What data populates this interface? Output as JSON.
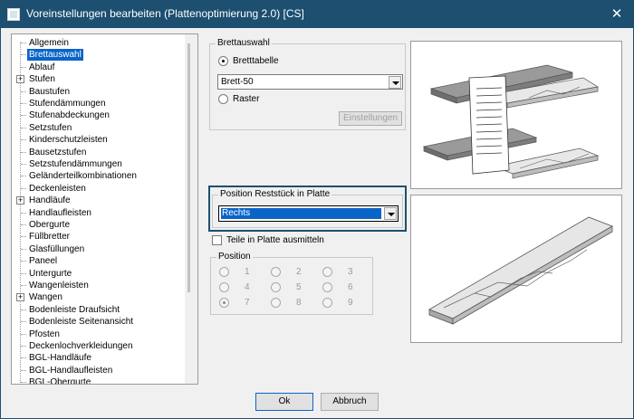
{
  "window": {
    "title": "Voreinstellungen bearbeiten (Plattenoptimierung 2.0) [CS]",
    "close_glyph": "✕"
  },
  "tree": {
    "items": [
      {
        "label": "Allgemein",
        "expandable": false,
        "selected": false
      },
      {
        "label": "Brettauswahl",
        "expandable": false,
        "selected": true
      },
      {
        "label": "Ablauf",
        "expandable": false,
        "selected": false
      },
      {
        "label": "Stufen",
        "expandable": true,
        "selected": false
      },
      {
        "label": "Baustufen",
        "expandable": false,
        "selected": false
      },
      {
        "label": "Stufendämmungen",
        "expandable": false,
        "selected": false
      },
      {
        "label": "Stufenabdeckungen",
        "expandable": false,
        "selected": false
      },
      {
        "label": "Setzstufen",
        "expandable": false,
        "selected": false
      },
      {
        "label": "Kinderschutzleisten",
        "expandable": false,
        "selected": false
      },
      {
        "label": "Bausetzstufen",
        "expandable": false,
        "selected": false
      },
      {
        "label": "Setzstufendämmungen",
        "expandable": false,
        "selected": false
      },
      {
        "label": "Geländerteilkombinationen",
        "expandable": false,
        "selected": false
      },
      {
        "label": "Deckenleisten",
        "expandable": false,
        "selected": false
      },
      {
        "label": "Handläufe",
        "expandable": true,
        "selected": false
      },
      {
        "label": "Handlaufleisten",
        "expandable": false,
        "selected": false
      },
      {
        "label": "Obergurte",
        "expandable": false,
        "selected": false
      },
      {
        "label": "Füllbretter",
        "expandable": false,
        "selected": false
      },
      {
        "label": "Glasfüllungen",
        "expandable": false,
        "selected": false
      },
      {
        "label": "Paneel",
        "expandable": false,
        "selected": false
      },
      {
        "label": "Untergurte",
        "expandable": false,
        "selected": false
      },
      {
        "label": "Wangenleisten",
        "expandable": false,
        "selected": false
      },
      {
        "label": "Wangen",
        "expandable": true,
        "selected": false
      },
      {
        "label": "Bodenleiste Draufsicht",
        "expandable": false,
        "selected": false
      },
      {
        "label": "Bodenleiste Seitenansicht",
        "expandable": false,
        "selected": false
      },
      {
        "label": "Pfosten",
        "expandable": false,
        "selected": false
      },
      {
        "label": "Deckenlochverkleidungen",
        "expandable": false,
        "selected": false
      },
      {
        "label": "BGL-Handläufe",
        "expandable": false,
        "selected": false
      },
      {
        "label": "BGL-Handlaufleisten",
        "expandable": false,
        "selected": false
      },
      {
        "label": "BGL-Obergurte",
        "expandable": false,
        "selected": false
      }
    ]
  },
  "brettauswahl": {
    "legend": "Brettauswahl",
    "radio_table": "Bretttabelle",
    "table_value": "Brett-50",
    "radio_raster": "Raster",
    "settings_button": "Einstellungen"
  },
  "position_rest": {
    "legend": "Position Reststück in Platte",
    "value": "Rechts"
  },
  "center_checkbox": {
    "label": "Teile in Platte ausmitteln",
    "checked": false
  },
  "position_group": {
    "legend": "Position",
    "options": [
      "1",
      "2",
      "3",
      "4",
      "5",
      "6",
      "7",
      "8",
      "9"
    ],
    "selected": "7"
  },
  "buttons": {
    "ok": "Ok",
    "cancel": "Abbruch"
  },
  "colors": {
    "titlebar": "#1d4f70",
    "selection": "#0a64c8",
    "highlight_frame": "#1d4f70"
  }
}
